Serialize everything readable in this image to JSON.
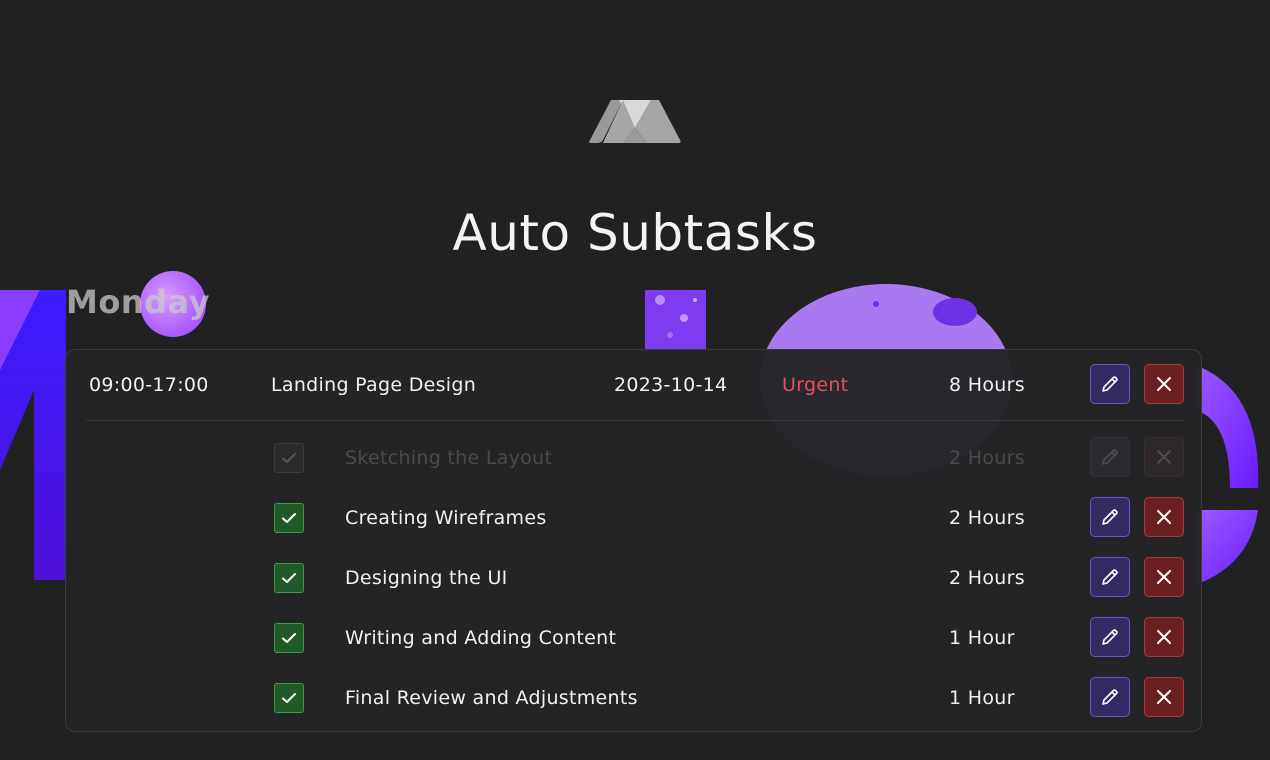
{
  "page": {
    "title": "Auto Subtasks",
    "day": "Monday"
  },
  "colors": {
    "background": "#212121",
    "accent_purple": "#7b2cff",
    "urgent": "#e3525a",
    "edit_button": "#332a63",
    "delete_button": "#6a1f22",
    "check_green": "#1f5a28"
  },
  "task": {
    "time": "09:00-17:00",
    "name": "Landing Page Design",
    "date": "2023-10-14",
    "priority": "Urgent",
    "duration": "8 Hours"
  },
  "subtasks": [
    {
      "name": "Sketching the Layout",
      "duration": "2 Hours",
      "checked": true,
      "disabled": true
    },
    {
      "name": "Creating Wireframes",
      "duration": "2 Hours",
      "checked": true,
      "disabled": false
    },
    {
      "name": "Designing the UI",
      "duration": "2 Hours",
      "checked": true,
      "disabled": false
    },
    {
      "name": "Writing and Adding Content",
      "duration": "1 Hour",
      "checked": true,
      "disabled": false
    },
    {
      "name": "Final Review and Adjustments",
      "duration": "1 Hour",
      "checked": true,
      "disabled": false
    }
  ],
  "icons": {
    "logo": "app-logo",
    "edit": "pencil-icon",
    "delete": "close-icon",
    "check": "checkmark-icon"
  }
}
